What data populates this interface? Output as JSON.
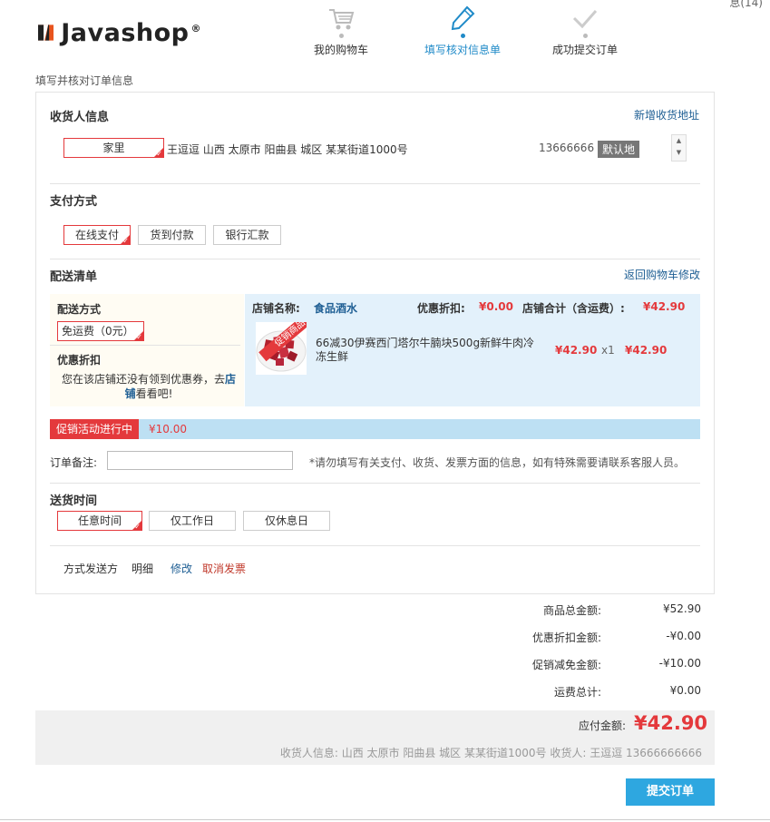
{
  "corner": {
    "text": "息(14)"
  },
  "logo": {
    "text": "Javashop",
    "reg": "®"
  },
  "steps": [
    {
      "label": "我的购物车",
      "icon": "cart-icon"
    },
    {
      "label": "填写核对信息单",
      "icon": "pencil-icon"
    },
    {
      "label": "成功提交订单",
      "icon": "check-icon"
    }
  ],
  "page_hint": "填写并核对订单信息",
  "receiver": {
    "title": "收货人信息",
    "add_link": "新增收货地址",
    "tag": "家里",
    "address": "王逗逗 山西 太原市 阳曲县 城区 某某街道1000号",
    "phone": "13666666",
    "default_badge": "默认地"
  },
  "payment": {
    "title": "支付方式",
    "options": [
      "在线支付",
      "货到付款",
      "银行汇款"
    ]
  },
  "delivery": {
    "title": "配送清单",
    "back_link": "返回购物车修改",
    "method_title": "配送方式",
    "method_value": "免运费（0元）",
    "discount_title": "优惠折扣",
    "discount_text_1": "您在该店铺还没有领到优惠券，去",
    "discount_link": "店铺",
    "discount_text_2": "看看吧!",
    "store_label": "店铺名称:",
    "store_name": "食品酒水",
    "discount_label": "优惠折扣:",
    "discount_value": "¥0.00",
    "total_label": "店铺合计（含运费）:",
    "total_value": "¥42.90",
    "product_ribbon": "促销商品",
    "product_name": "66减30伊赛西门塔尔牛腩块500g新鲜牛肉冷冻生鲜",
    "product_price": "¥42.90",
    "product_qty": "x1",
    "product_subtotal": "¥42.90"
  },
  "promo": {
    "tag": "促销活动进行中",
    "value": "¥10.00"
  },
  "note": {
    "label": "订单备注:",
    "placeholder": "",
    "hint": "*请勿填写有关支付、收货、发票方面的信息，如有特殊需要请联系客服人员。"
  },
  "ship_time": {
    "title": "送货时间",
    "options": [
      "任意时间",
      "仅工作日",
      "仅休息日"
    ]
  },
  "invoice": {
    "label1": "方式发送方",
    "label2": "明细",
    "modify": "修改",
    "cancel": "取消发票"
  },
  "summary": [
    {
      "label": "商品总金额:",
      "value": "¥52.90"
    },
    {
      "label": "优惠折扣金额:",
      "value": "-¥0.00"
    },
    {
      "label": "促销减免金额:",
      "value": "-¥10.00"
    },
    {
      "label": "运费总计:",
      "value": "¥0.00"
    }
  ],
  "payable": {
    "label": "应付金额:",
    "value": "¥42.90",
    "receiver_line": "收货人信息: 山西 太原市 阳曲县 城区 某某街道1000号 收货人: 王逗逗 13666666666"
  },
  "submit": {
    "label": "提交订单"
  },
  "colors": {
    "accent_red": "#e4393c",
    "accent_blue": "#2ea7e0",
    "link_blue": "#1f5f94"
  }
}
